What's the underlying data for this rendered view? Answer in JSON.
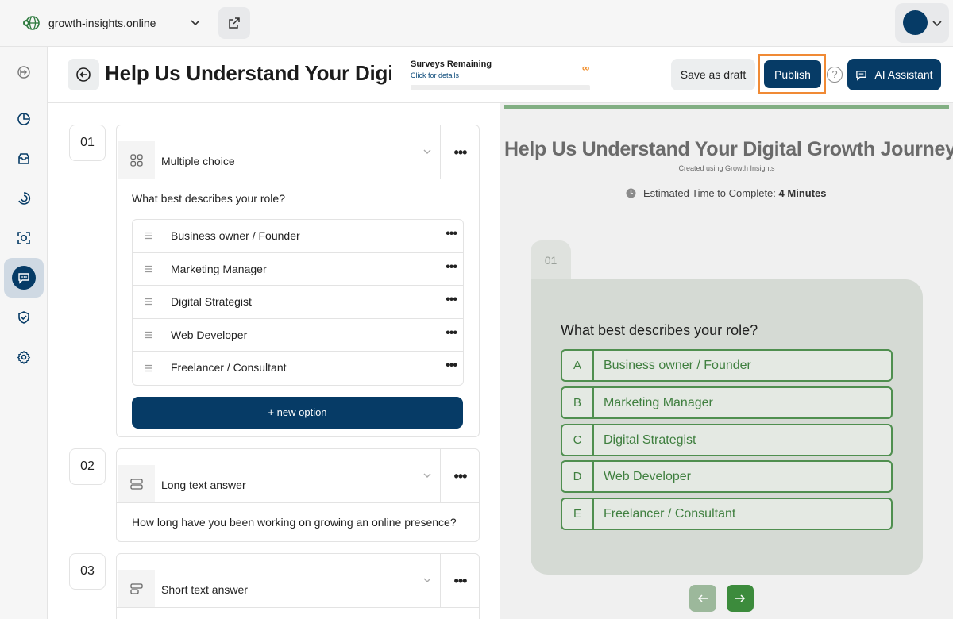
{
  "topbar": {
    "site_name": "growth-insights.online"
  },
  "header": {
    "title": "Help Us Understand Your Digit",
    "surveys_title": "Surveys Remaining",
    "surveys_link": "Click for details",
    "surveys_value": "∞",
    "save_draft_label": "Save as draft",
    "publish_label": "Publish",
    "help_label": "?",
    "ai_label": "AI Assistant"
  },
  "sidebar": {
    "items": [
      {
        "icon": "collapse-sidebar-icon"
      },
      {
        "icon": "chart-pie-icon"
      },
      {
        "icon": "inbox-icon"
      },
      {
        "icon": "analytics-icon"
      },
      {
        "icon": "focus-icon"
      },
      {
        "icon": "survey-chat-icon",
        "active": true
      },
      {
        "icon": "shield-check-icon"
      },
      {
        "icon": "gear-icon"
      }
    ]
  },
  "questions": [
    {
      "number": "01",
      "type": "Multiple choice",
      "icon": "grid-icon",
      "text": "What best describes your role?",
      "options": [
        "Business owner / Founder",
        "Marketing Manager",
        "Digital Strategist",
        "Web Developer",
        "Freelancer / Consultant"
      ],
      "new_option_label": "+ new option"
    },
    {
      "number": "02",
      "type": "Long text answer",
      "icon": "long-text-icon",
      "text": "How long have you been working on growing an online presence?"
    },
    {
      "number": "03",
      "type": "Short text answer",
      "icon": "short-text-icon"
    }
  ],
  "preview": {
    "title": "Help Us Understand Your Digital Growth Journey",
    "subtitle": "Created using Growth Insights",
    "time_label": "Estimated Time to Complete:",
    "time_value": "4 Minutes",
    "tab_number": "01",
    "question": "What best describes your role?",
    "options": [
      {
        "letter": "A",
        "label": "Business owner / Founder"
      },
      {
        "letter": "B",
        "label": "Marketing Manager"
      },
      {
        "letter": "C",
        "label": "Digital Strategist"
      },
      {
        "letter": "D",
        "label": "Web Developer"
      },
      {
        "letter": "E",
        "label": "Freelancer / Consultant"
      }
    ]
  },
  "colors": {
    "brand": "#063b66",
    "highlight": "#f08a35",
    "preview_green": "#4f8f4f"
  }
}
